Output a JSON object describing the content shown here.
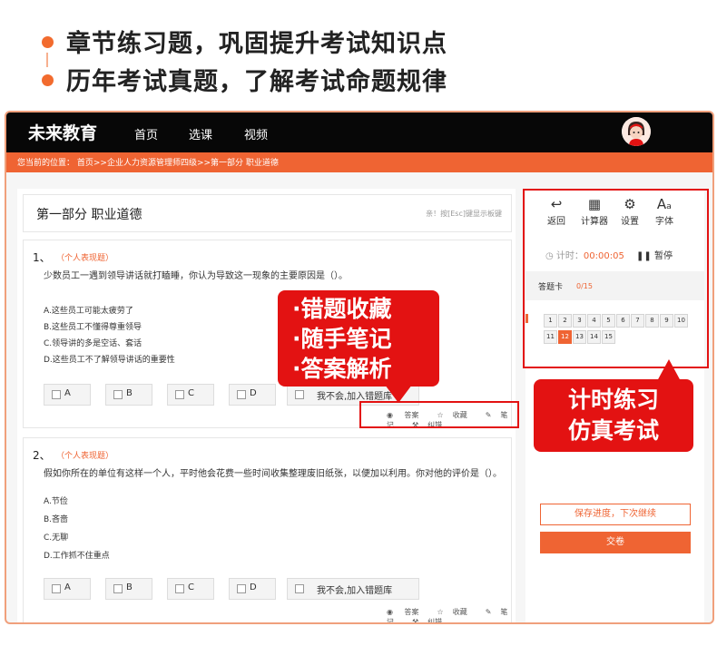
{
  "promo": {
    "line1": "章节练习题，巩固提升考试知识点",
    "line2": "历年考试真题，了解考试命题规律"
  },
  "topnav": {
    "brand": "未来教育",
    "items": [
      "首页",
      "选课",
      "视频"
    ]
  },
  "breadcrumb": "您当前的位置： 首页>>企业人力资源管理师四级>>第一部分 职业道德",
  "section": {
    "title": "第一部分 职业道德",
    "hint": "亲！按[Esc]键显示板键"
  },
  "questions": [
    {
      "number": "1、",
      "type": "（个人表现题）",
      "text": "少数员工一遇到领导讲话就打瞌睡，你认为导致这一现象的主要原因是（）。",
      "options": [
        "A.这些员工可能太疲劳了",
        "B.这些员工不懂得尊重领导",
        "C.领导讲的多是空话、套话",
        "D.这些员工不了解领导讲话的重要性"
      ],
      "answers": [
        "A",
        "B",
        "C",
        "D",
        "我不会,加入错题库"
      ]
    },
    {
      "number": "2、",
      "type": "（个人表现题）",
      "text": "假如你所在的单位有这样一个人，平时他会花费一些时间收集整理废旧纸张，以便加以利用。你对他的评价是（）。",
      "options": [
        "A.节俭",
        "B.吝啬",
        "C.无聊",
        "D.工作抓不住重点"
      ],
      "answers": [
        "A",
        "B",
        "C",
        "D",
        "我不会,加入错题库"
      ]
    }
  ],
  "question_tools": [
    "答案",
    "收藏",
    "笔记",
    "纠错"
  ],
  "panel": {
    "tools": [
      {
        "icon": "back-icon",
        "label": "返回"
      },
      {
        "icon": "calculator-icon",
        "label": "计算器"
      },
      {
        "icon": "gear-icon",
        "label": "设置"
      },
      {
        "icon": "font-icon",
        "label": "字体"
      }
    ],
    "timer_label": "计时：",
    "timer_value": "00:00:05",
    "pause_label": "暂停",
    "card_label": "答题卡",
    "card_count": "0/15",
    "cells": [
      "1",
      "2",
      "3",
      "4",
      "5",
      "6",
      "7",
      "8",
      "9",
      "10",
      "11",
      "12",
      "13",
      "14",
      "15"
    ],
    "active_cell": "12",
    "save_label": "保存进度，下次继续",
    "submit_label": "交卷"
  },
  "callouts": {
    "features": [
      "·错题收藏",
      "·随手笔记",
      "·答案解析"
    ],
    "timer_practice": [
      "计时练习",
      "仿真考试"
    ]
  },
  "colors": {
    "accent": "#ef6433",
    "callout": "#e31212",
    "nav": "#070707"
  }
}
